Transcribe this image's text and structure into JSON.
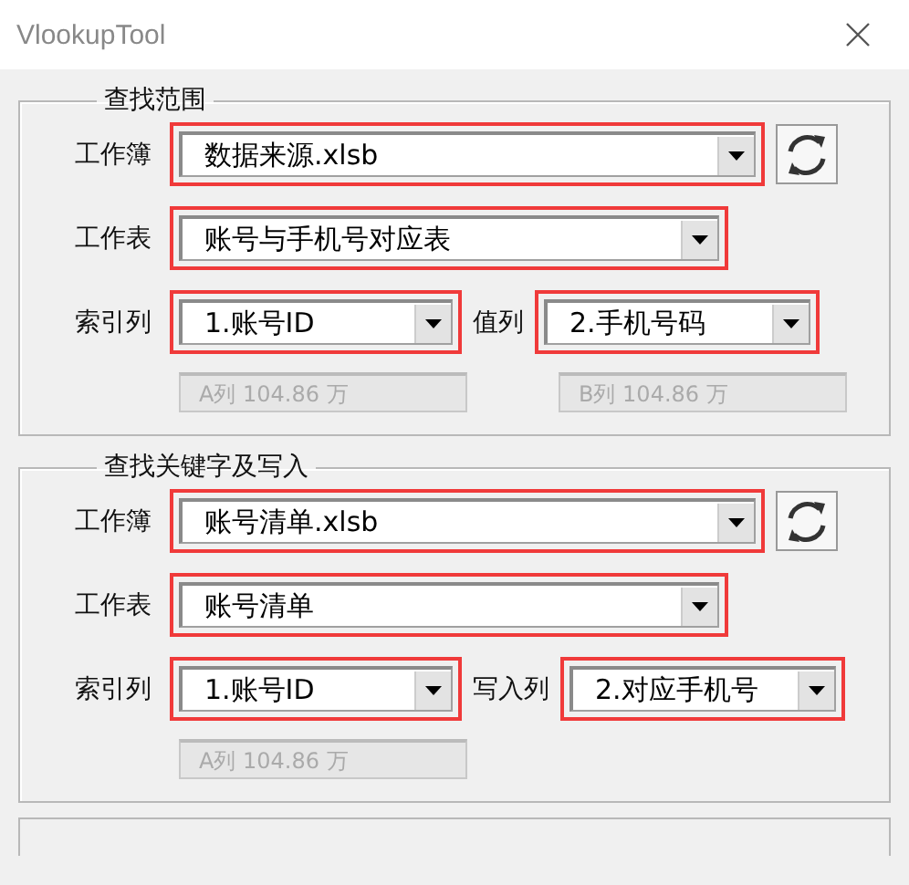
{
  "window": {
    "title": "VlookupTool"
  },
  "groups": [
    {
      "title": "查找范围",
      "workbook": {
        "label": "工作簿",
        "value": "数据来源.xlsb",
        "highlighted": true
      },
      "sheet": {
        "label": "工作表",
        "value": "账号与手机号对应表",
        "highlighted": true
      },
      "index": {
        "label": "索引列",
        "value": "1.账号ID",
        "highlighted": true
      },
      "target": {
        "label": "值列",
        "value": "2.手机号码",
        "highlighted": true
      },
      "infos": [
        "A列 104.86 万",
        "B列 104.86 万"
      ]
    },
    {
      "title": "查找关键字及写入",
      "workbook": {
        "label": "工作簿",
        "value": "账号清单.xlsb",
        "highlighted": true
      },
      "sheet": {
        "label": "工作表",
        "value": "账号清单",
        "highlighted": true
      },
      "index": {
        "label": "索引列",
        "value": "1.账号ID",
        "highlighted": true
      },
      "target": {
        "label": "写入列",
        "value": "2.对应手机号",
        "highlighted": true
      },
      "infos": [
        "A列 104.86 万"
      ]
    }
  ]
}
